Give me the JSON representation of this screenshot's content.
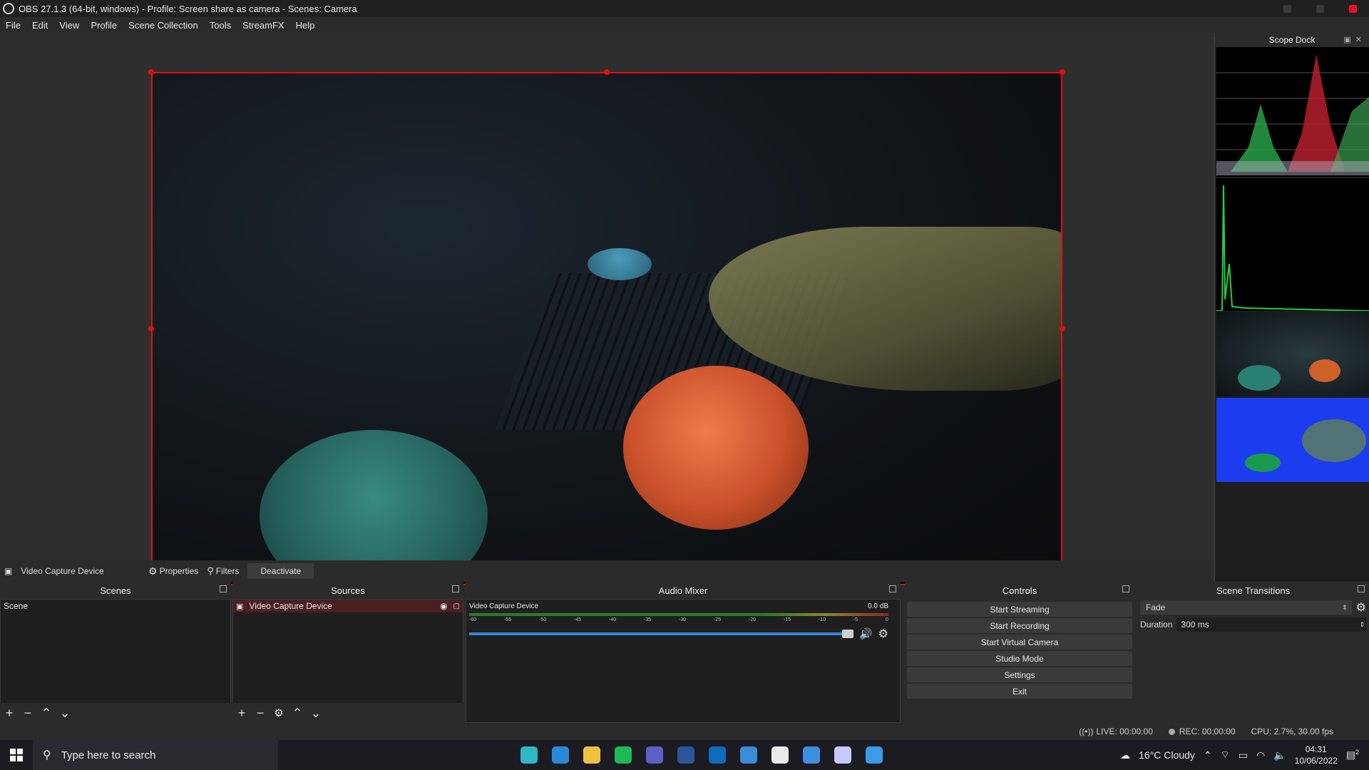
{
  "window": {
    "title": "OBS 27.1.3 (64-bit, windows) - Profile: Screen share as camera - Scenes: Camera"
  },
  "menu": [
    "File",
    "Edit",
    "View",
    "Profile",
    "Scene Collection",
    "Tools",
    "StreamFX",
    "Help"
  ],
  "scope_dock": {
    "title": "Scope Dock"
  },
  "source_toolbar": {
    "source_name": "Video Capture Device",
    "properties_label": "Properties",
    "filters_label": "Filters",
    "deactivate_label": "Deactivate"
  },
  "scenes": {
    "title": "Scenes",
    "items": [
      "Scene"
    ]
  },
  "sources": {
    "title": "Sources",
    "items": [
      "Video Capture Device"
    ]
  },
  "mixer": {
    "title": "Audio Mixer",
    "channel_name": "Video Capture Device",
    "channel_db": "0.0 dB",
    "ticks": [
      "-60",
      "-55",
      "-50",
      "-45",
      "-40",
      "-35",
      "-30",
      "-25",
      "-20",
      "-15",
      "-10",
      "-5",
      "0"
    ],
    "volume_level": 1.0
  },
  "controls": {
    "title": "Controls",
    "buttons": [
      "Start Streaming",
      "Start Recording",
      "Start Virtual Camera",
      "Studio Mode",
      "Settings",
      "Exit"
    ]
  },
  "transitions": {
    "title": "Scene Transitions",
    "selected": "Fade",
    "duration_label": "Duration",
    "duration_value": "300 ms"
  },
  "status": {
    "live": "LIVE: 00:00:00",
    "rec": "REC: 00:00:00",
    "cpu": "CPU: 2.7%, 30.00 fps"
  },
  "taskbar": {
    "search_placeholder": "Type here to search",
    "weather": "16°C  Cloudy",
    "time": "04:31",
    "date": "10/06/2022",
    "notification_count": "2",
    "apps": [
      "edge-icon",
      "vscode-icon",
      "file-explorer-icon",
      "spotify-icon",
      "teams-icon",
      "word-icon",
      "outlook-icon",
      "app-icon",
      "obs-icon",
      "app2-icon",
      "app3-icon",
      "app4-icon"
    ],
    "app_colors": [
      "#2fb7c8",
      "#2a8ad8",
      "#f0c040",
      "#1db954",
      "#5b5fc7",
      "#2b579a",
      "#0f6cbd",
      "#3c8cd8",
      "#eaeaea",
      "#3d8fe0",
      "#c8c8ff",
      "#3b9be8"
    ]
  }
}
